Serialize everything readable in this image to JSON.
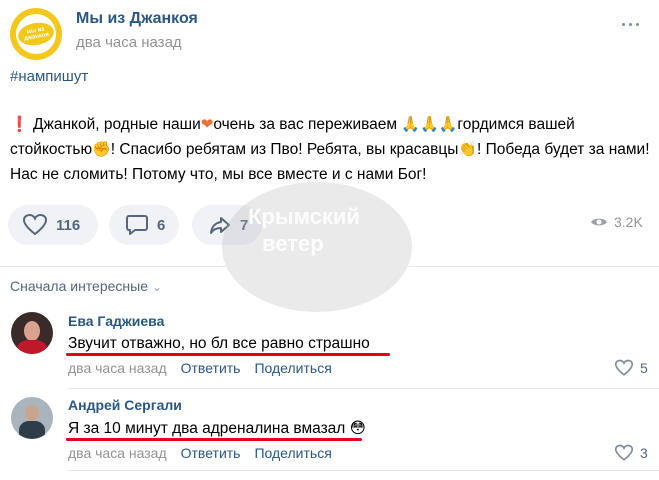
{
  "post": {
    "group_name": "Мы из Джанкоя",
    "group_logo_text": "мы из джанкоя",
    "time": "два часа назад",
    "hashtag": "#нампишут",
    "text_parts": {
      "p1": "Джанкой, родные наши",
      "p2": "очень за вас переживаем ",
      "p3": "гордимся вашей стойкостью",
      "p4": "! Спасибо ребятам из Пво! Ребята, вы красавцы",
      "p5": "! Победа будет за нами! Нас не сломить! Потому что, мы все вместе и с нами Бог!"
    },
    "emojis": {
      "exclamation": "❗",
      "heart": "❤",
      "pray": "🙏🙏🙏",
      "fist": "✊",
      "clap": "👏"
    }
  },
  "actions": {
    "likes": "116",
    "comments": "6",
    "shares": "7",
    "views": "3.2K"
  },
  "watermark": {
    "line1": "Крымский",
    "line2": "ветер"
  },
  "comments_section": {
    "sort_label": "Сначала интересные",
    "items": [
      {
        "author": "Ева Гаджиева",
        "text": "Звучит отважно, но бл все равно страшно",
        "time": "два часа назад",
        "reply": "Ответить",
        "share": "Поделиться",
        "likes": "5"
      },
      {
        "author": "Андрей Сергали",
        "text": "Я за 10 минут два адреналина вмазал",
        "emoji": "😳",
        "time": "два часа назад",
        "reply": "Ответить",
        "share": "Поделиться",
        "likes": "3"
      }
    ]
  },
  "colors": {
    "link": "#2a5885",
    "muted": "#939393",
    "pill_bg": "#f0f2f5",
    "underline_red": "#e3001b",
    "logo_yellow": "#f3c71b"
  }
}
